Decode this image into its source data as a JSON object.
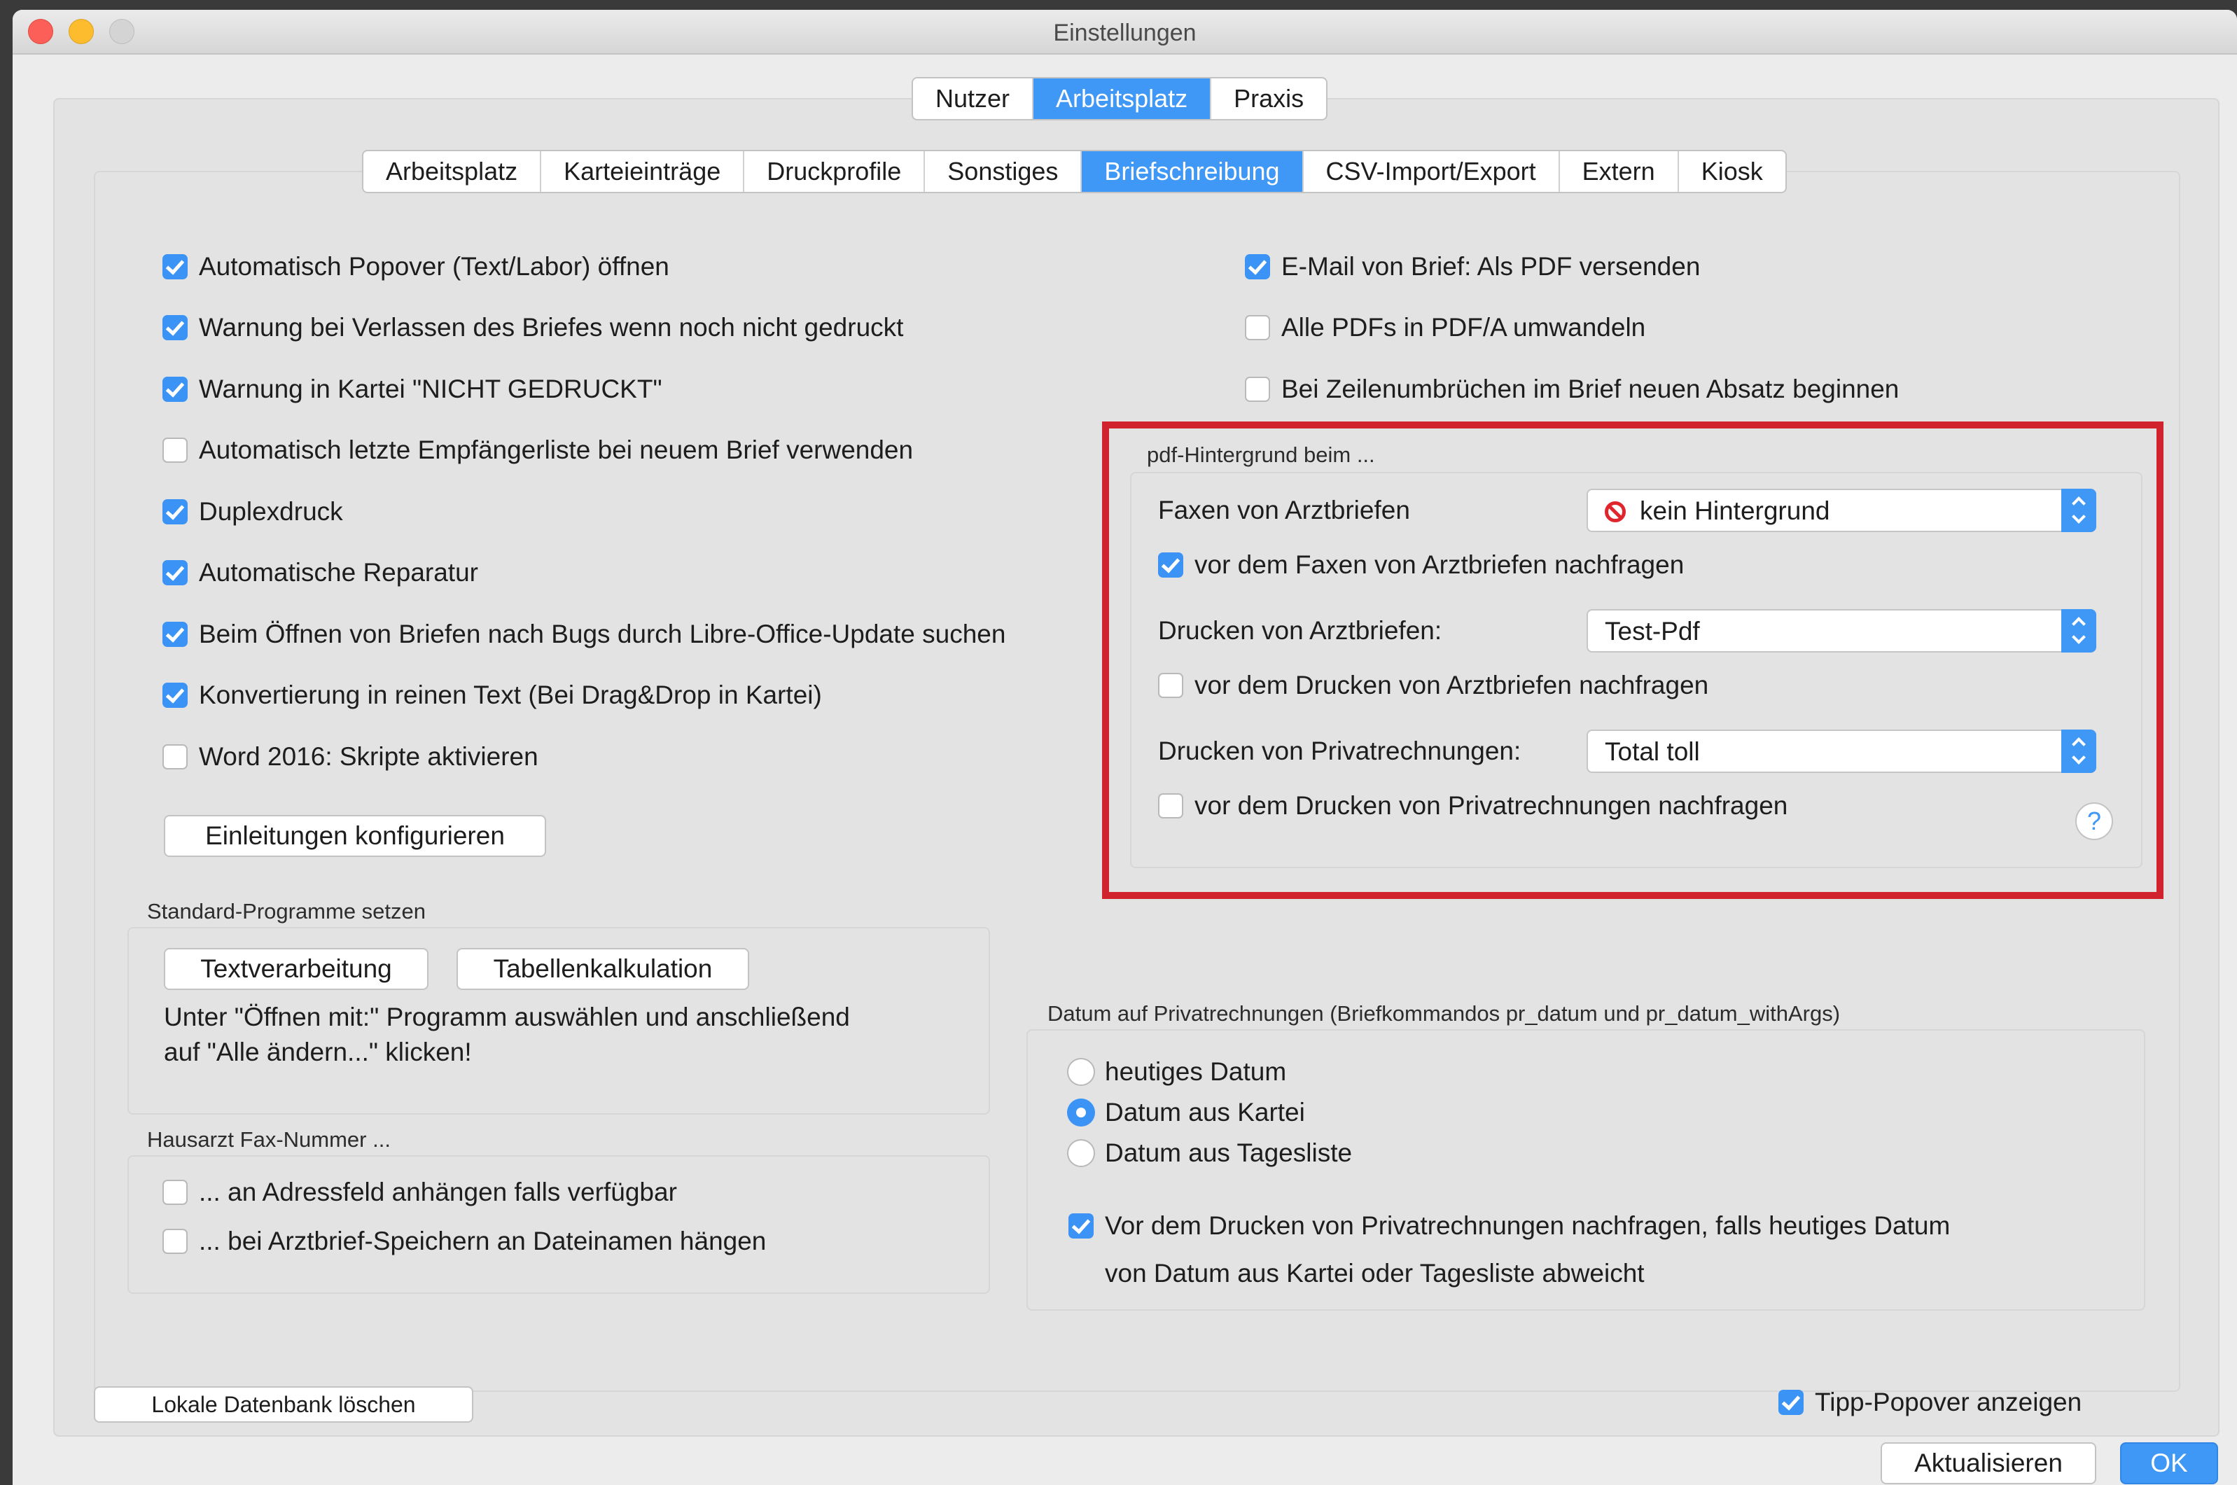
{
  "window": {
    "title": "Einstellungen"
  },
  "top_tabs": [
    "Nutzer",
    "Arbeitsplatz",
    "Praxis"
  ],
  "sub_tabs": [
    "Arbeitsplatz",
    "Karteieinträge",
    "Druckprofile",
    "Sonstiges",
    "Briefschreibung",
    "CSV-Import/Export",
    "Extern",
    "Kiosk"
  ],
  "left_options": [
    "Automatisch Popover (Text/Labor) öffnen",
    "Warnung bei Verlassen des Briefes wenn noch nicht gedruckt",
    "Warnung in Kartei \"NICHT GEDRUCKT\"",
    "Automatisch letzte Empfängerliste bei neuem Brief verwenden",
    "Duplexdruck",
    "Automatische Reparatur",
    "Beim Öffnen von Briefen nach Bugs durch Libre-Office-Update suchen",
    "Konvertierung in reinen Text (Bei Drag&Drop in Kartei)",
    "Word 2016: Skripte aktivieren"
  ],
  "right_options": [
    "E-Mail von Brief: Als PDF versenden",
    "Alle PDFs in PDF/A umwandeln",
    "Bei Zeilenumbrüchen im Brief neuen Absatz beginnen"
  ],
  "einleitungen_button": "Einleitungen konfigurieren",
  "standard_programme": {
    "title": "Standard-Programme setzen",
    "btn_text": "Textverarbeitung",
    "btn_table": "Tabellenkalkulation",
    "hint_line1": "Unter \"Öffnen mit:\" Programm auswählen und anschließend",
    "hint_line2": "auf \"Alle ändern...\" klicken!"
  },
  "hausarzt": {
    "title": "Hausarzt Fax-Nummer ...",
    "opt1": "... an Adressfeld anhängen falls verfügbar",
    "opt2": "... bei Arztbrief-Speichern an Dateinamen hängen"
  },
  "pdf_hintergrund": {
    "title": "pdf-Hintergrund beim ...",
    "fax_label": "Faxen von Arztbriefen",
    "fax_value": "kein Hintergrund",
    "fax_ask": "vor dem Faxen von Arztbriefen nachfragen",
    "druck_label": "Drucken von Arztbriefen:",
    "druck_value": "Test-Pdf",
    "druck_ask": "vor dem Drucken von Arztbriefen nachfragen",
    "privat_label": "Drucken von Privatrechnungen:",
    "privat_value": "Total toll",
    "privat_ask": "vor dem Drucken von Privatrechnungen nachfragen",
    "help": "?"
  },
  "datum": {
    "title": "Datum auf Privatrechnungen (Briefkommandos pr_datum und pr_datum_withArgs)",
    "opt1": "heutiges Datum",
    "opt2": "Datum aus Kartei",
    "opt3": "Datum aus Tagesliste",
    "ask_line1": "Vor dem Drucken von Privatrechnungen nachfragen, falls heutiges Datum",
    "ask_line2": "von Datum aus Kartei oder Tagesliste abweicht"
  },
  "footer": {
    "delete_db": "Lokale Datenbank löschen",
    "tipp": "Tipp-Popover anzeigen",
    "refresh": "Aktualisieren",
    "ok": "OK"
  },
  "colors": {
    "accent": "#3f97f6",
    "highlight": "#d1232e"
  }
}
